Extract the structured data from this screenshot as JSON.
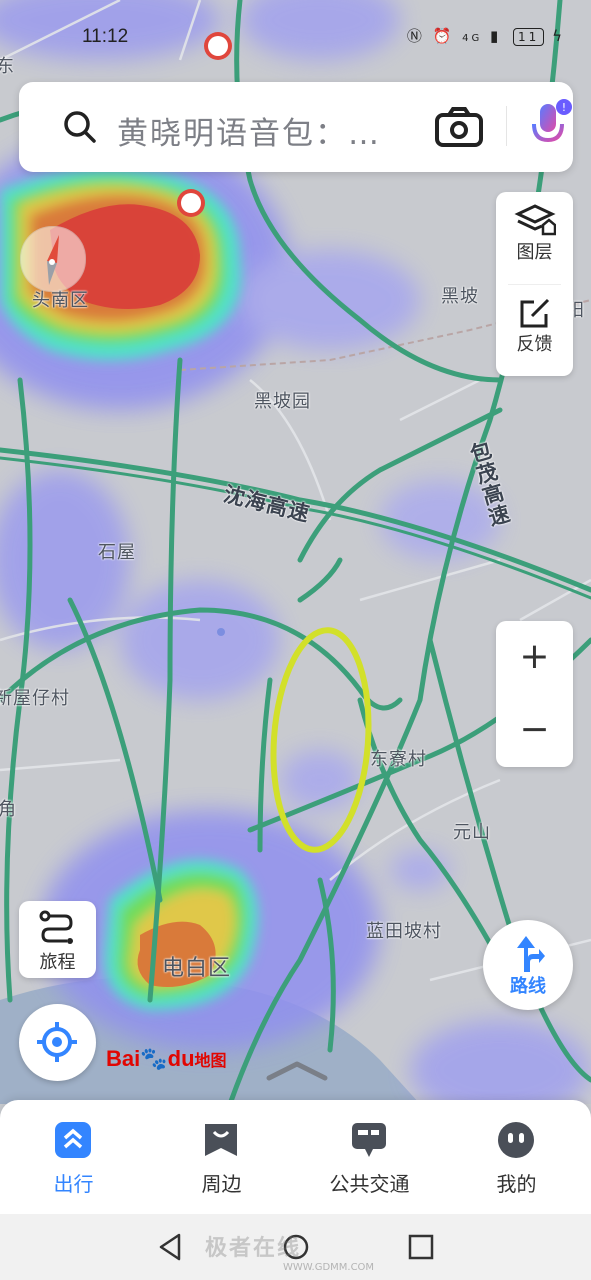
{
  "status_bar": {
    "time": "11:12",
    "network": "4G",
    "battery": "11"
  },
  "search": {
    "placeholder": "黄晓明语音包：…"
  },
  "side_panel": {
    "layers_label": "图层",
    "feedback_label": "反馈"
  },
  "zoom": {
    "in_label": "+",
    "out_label": "−"
  },
  "route_button": {
    "label": "路线"
  },
  "trip_button": {
    "label": "旅程"
  },
  "logo": {
    "bai": "Bai",
    "du": "du",
    "suffix": "地图"
  },
  "map_labels": {
    "district_top": "头南区",
    "place_heipo": "黑坡",
    "place_heipoyuan": "黑坡园",
    "road_shenhai": "沈海高速",
    "road_baomao": "包茂高速",
    "place_shiwu": "石屋",
    "place_xinwuzai": "新屋仔村",
    "place_dongliao": "东寮村",
    "place_yuanshan": "元山",
    "place_lantianpo": "蓝田坡村",
    "district_bottom": "电白区",
    "edge_top_left": "东",
    "edge_left": "角",
    "edge_right": "阳"
  },
  "bottom_nav": {
    "tabs": [
      {
        "label": "出行",
        "active": true,
        "icon": "travel-icon"
      },
      {
        "label": "周边",
        "active": false,
        "icon": "nearby-icon"
      },
      {
        "label": "公共交通",
        "active": false,
        "icon": "bus-icon"
      },
      {
        "label": "我的",
        "active": false,
        "icon": "profile-icon"
      }
    ]
  },
  "watermark": {
    "text": "极者在线",
    "url": "WWW.GDMM.COM"
  },
  "colors": {
    "accent": "#3385ff",
    "highway": "#3c9f7a",
    "annotation": "#d2e02a"
  }
}
